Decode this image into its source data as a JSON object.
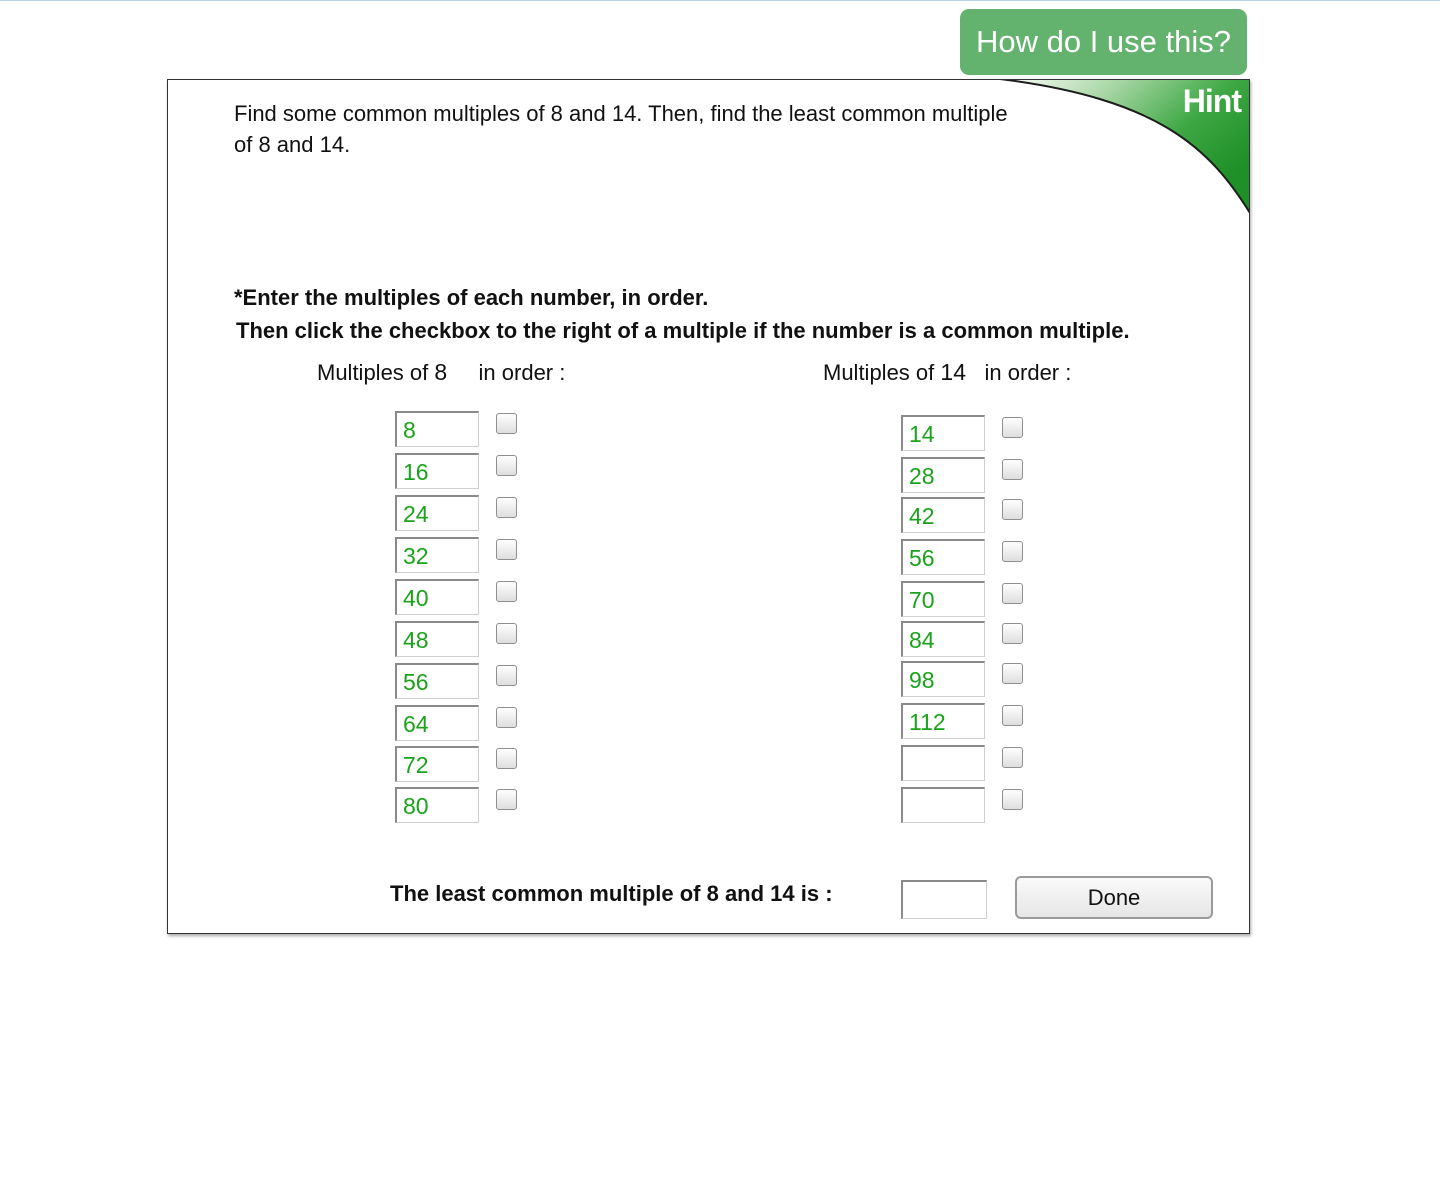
{
  "help_button": {
    "label": "How do I use this?"
  },
  "hint": {
    "label": "Hint"
  },
  "question": {
    "text": "Find some common multiples of 8 and 14. Then, find the least common multiple of 8 and 14."
  },
  "instructions": {
    "line1": "*Enter the multiples of each number, in order.",
    "line2": "Then click the checkbox to the right of a multiple if the number is a common multiple."
  },
  "left_column": {
    "prefix": "Multiples of",
    "number": "8",
    "suffix": "in order :",
    "entries": [
      "8",
      "16",
      "24",
      "32",
      "40",
      "48",
      "56",
      "64",
      "72",
      "80"
    ],
    "checked": [
      false,
      false,
      false,
      false,
      false,
      false,
      false,
      false,
      false,
      false
    ]
  },
  "right_column": {
    "prefix": "Multiples of",
    "number": "14",
    "suffix": "in order :",
    "entries": [
      "14",
      "28",
      "42",
      "56",
      "70",
      "84",
      "98",
      "112",
      "",
      ""
    ],
    "checked": [
      false,
      false,
      false,
      false,
      false,
      false,
      false,
      false,
      false,
      false
    ]
  },
  "answer": {
    "label": "The least common multiple of 8 and 14 is :",
    "value": "",
    "done_label": "Done"
  },
  "colors": {
    "help_button": "#63b26e",
    "hint_green": "#23982b",
    "entry_text": "#1aa31a"
  }
}
